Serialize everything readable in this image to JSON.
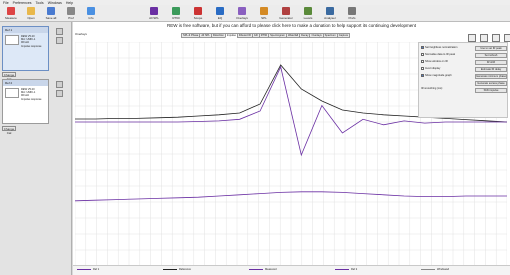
{
  "menu": [
    "File",
    "Preferences",
    "Tools",
    "Windows",
    "Help"
  ],
  "toolbar": [
    {
      "label": "Measure",
      "icon": "measure-icon"
    },
    {
      "label": "Open",
      "icon": "open-folder-icon"
    },
    {
      "label": "Save all",
      "icon": "save-all-icon"
    },
    {
      "label": "Pref",
      "icon": "preferences-icon"
    },
    {
      "label": "Info",
      "icon": "info-icon"
    },
    {
      "label": "All SPL",
      "icon": "all-spl-icon"
    },
    {
      "label": "RT60",
      "icon": "rt60-icon"
    },
    {
      "label": "Scope",
      "icon": "scope-icon"
    },
    {
      "label": "EQ",
      "icon": "eq-icon"
    },
    {
      "label": "Overlays",
      "icon": "overlays-icon"
    },
    {
      "label": "SPL",
      "icon": "spl-meter-icon"
    },
    {
      "label": "Generator",
      "icon": "generator-icon"
    },
    {
      "label": "Levels",
      "icon": "levels-icon"
    },
    {
      "label": "Analyser",
      "icon": "analyser-icon"
    },
    {
      "label": "Prefs",
      "icon": "gear-icon"
    }
  ],
  "banner": "REW is free software, but if you can afford to please click here to make a donation to help support its continuing development",
  "leftlabel": "Overlays",
  "tabs": [
    "SPL & Phase",
    "All SPL",
    "Distortion",
    "Impulse",
    "Filtered IR",
    "GD",
    "RT60",
    "Spectrogram",
    "Waterfall",
    "Decay",
    "Overlays",
    "Spectrum",
    "Capture"
  ],
  "active_tab": "Impulse",
  "measurements": [
    {
      "title": "Ref 1",
      "lines": [
        "REW V5.20",
        "Mic: UMIK-1",
        "96 kHz",
        "Impulse response"
      ]
    },
    {
      "title": "Ref 2",
      "lines": [
        "REW V5.20",
        "Mic: UMIK-1",
        "96 kHz",
        "Impulse response"
      ]
    }
  ],
  "left_buttons": [
    "Change Cal",
    "Change Cal"
  ],
  "controls": {
    "checks": [
      {
        "label": "Set heightless normalization",
        "on": true
      },
      {
        "label": "Normalise data to IR peak",
        "on": false
      },
      {
        "label": "Show window on IR",
        "on": false
      },
      {
        "label": "Invert display",
        "on": false
      },
      {
        "label": "Show magnitude graph",
        "on": true
      }
    ],
    "buttons": [
      "Use to set IR peak",
      "Set refresh",
      "IR shift",
      "Estimate IR delay",
      "Generate minimum phase",
      "Generate excess phase",
      "Shift impulse"
    ],
    "smoothing_label": "IR smoothing (ms):"
  },
  "legend": [
    {
      "name": "Ref 1",
      "color": "#6a2fa3"
    },
    {
      "name": "Reference",
      "color": "#222222"
    },
    {
      "name": "Measured",
      "color": "#6a2fa3"
    },
    {
      "name": "Ref 2",
      "color": "#6a2fa3"
    },
    {
      "name": "Windowed",
      "color": "#888888"
    }
  ],
  "chart_data": {
    "type": "line",
    "xlabel": "",
    "ylabel": "",
    "grid": true,
    "series": [
      {
        "values": [
          0.05,
          0.05,
          0.06,
          0.06,
          0.07,
          0.08,
          0.1,
          0.12,
          0.15,
          0.3,
          0.95,
          0.55,
          0.35,
          0.2,
          0.15,
          0.12,
          0.1,
          0.08,
          0.06,
          0.04,
          0.02,
          0.0
        ]
      },
      {
        "values": [
          0.0,
          0.0,
          0.0,
          0.0,
          0.0,
          0.0,
          0.01,
          0.02,
          0.05,
          0.2,
          1.0,
          -0.6,
          0.3,
          -0.2,
          0.05,
          -0.05,
          0.02,
          -0.02,
          0.0,
          0.0,
          0.0,
          0.0
        ]
      },
      {
        "values": [
          0.02,
          0.03,
          0.04,
          0.05,
          0.06,
          0.07,
          0.08,
          0.1,
          0.12,
          0.14,
          0.16,
          0.17,
          0.17,
          0.16,
          0.14,
          0.12,
          0.1,
          0.09,
          0.09,
          0.1,
          0.1,
          0.1
        ]
      }
    ]
  }
}
